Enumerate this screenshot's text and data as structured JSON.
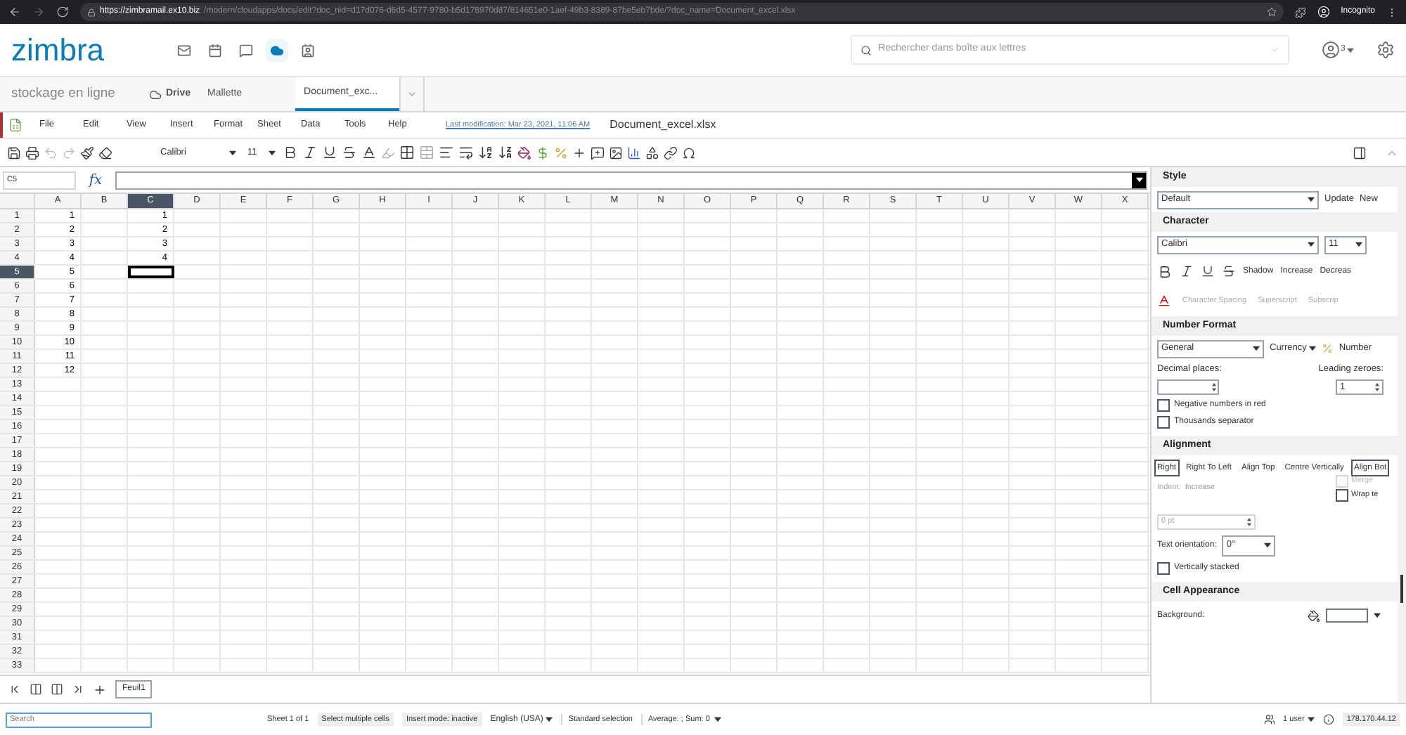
{
  "browser": {
    "url_host": "https://zimbramail.ex10.biz",
    "url_rest": "/modern/cloudapps/docs/edit?doc_nid=d17d076-d6d5-4577-9780-b5d178970d87/814651e0-1aef-49b3-8389-87be5eb7bde/?doc_name=Document_excel.xlsx",
    "profile": "Incognito"
  },
  "header": {
    "logo": "zimbra",
    "apps": [
      {
        "kind": "mail",
        "selected": false
      },
      {
        "kind": "calendar",
        "selected": false
      },
      {
        "kind": "chat",
        "selected": false
      },
      {
        "kind": "cloud",
        "selected": true
      },
      {
        "kind": "contacts",
        "selected": false
      }
    ],
    "search_placeholder": "Rechercher dans boîte aux lettres",
    "account_count": "3"
  },
  "tabs": {
    "title": "stockage en ligne",
    "items": [
      {
        "label": "Drive",
        "kind": "drive",
        "selected": false
      },
      {
        "label": "Mallette",
        "kind": "plain",
        "selected": false
      },
      {
        "label": "Document_exc...",
        "kind": "plain",
        "selected": true
      }
    ]
  },
  "menu": {
    "items": [
      "File",
      "Edit",
      "View",
      "Insert",
      "Format",
      "Sheet",
      "Data",
      "Tools",
      "Help"
    ],
    "last_modification": "Last modification: Mar 23, 2021, 11:06 AM",
    "document_title": "Document_excel.xlsx"
  },
  "toolbar": {
    "font": "Calibri",
    "size": "11"
  },
  "formula_bar": {
    "name_box": "C5",
    "fx": "fx"
  },
  "sheet": {
    "columns": [
      {
        "label": "A",
        "selected": false
      },
      {
        "label": "B",
        "selected": false
      },
      {
        "label": "C",
        "selected": true
      },
      {
        "label": "D",
        "selected": false
      },
      {
        "label": "E",
        "selected": false
      },
      {
        "label": "F",
        "selected": false
      },
      {
        "label": "G",
        "selected": false
      },
      {
        "label": "H",
        "selected": false
      },
      {
        "label": "I",
        "selected": false
      },
      {
        "label": "J",
        "selected": false
      },
      {
        "label": "K",
        "selected": false
      },
      {
        "label": "L",
        "selected": false
      },
      {
        "label": "M",
        "selected": false
      },
      {
        "label": "N",
        "selected": false
      },
      {
        "label": "O",
        "selected": false
      },
      {
        "label": "P",
        "selected": false
      },
      {
        "label": "Q",
        "selected": false
      },
      {
        "label": "R",
        "selected": false
      },
      {
        "label": "S",
        "selected": false
      },
      {
        "label": "T",
        "selected": false
      },
      {
        "label": "U",
        "selected": false
      },
      {
        "label": "V",
        "selected": false
      },
      {
        "label": "W",
        "selected": false
      },
      {
        "label": "X",
        "selected": false
      }
    ],
    "rows": [
      {
        "label": "1",
        "selected": false,
        "values": [
          "1",
          {
            "kind": "empty"
          },
          "1"
        ]
      },
      {
        "label": "2",
        "selected": false,
        "values": [
          "2",
          {
            "kind": "empty"
          },
          "2"
        ]
      },
      {
        "label": "3",
        "selected": false,
        "values": [
          "3",
          {
            "kind": "empty"
          },
          "3"
        ]
      },
      {
        "label": "4",
        "selected": false,
        "values": [
          "4",
          {
            "kind": "empty"
          },
          "4"
        ]
      },
      {
        "label": "5",
        "selected": true,
        "values": [
          "5"
        ]
      },
      {
        "label": "6",
        "selected": false,
        "values": [
          "6"
        ]
      },
      {
        "label": "7",
        "selected": false,
        "values": [
          "7"
        ]
      },
      {
        "label": "8",
        "selected": false,
        "values": [
          "8"
        ]
      },
      {
        "label": "9",
        "selected": false,
        "values": [
          "9"
        ]
      },
      {
        "label": "10",
        "selected": false,
        "values": [
          "10"
        ]
      },
      {
        "label": "11",
        "selected": false,
        "values": [
          "11"
        ]
      },
      {
        "label": "12",
        "selected": false,
        "values": [
          "12"
        ]
      },
      {
        "label": "13",
        "selected": false
      },
      {
        "label": "14",
        "selected": false
      },
      {
        "label": "15",
        "selected": false
      },
      {
        "label": "16",
        "selected": false
      },
      {
        "label": "17",
        "selected": false
      },
      {
        "label": "18",
        "selected": false
      },
      {
        "label": "19",
        "selected": false
      },
      {
        "label": "20",
        "selected": false
      },
      {
        "label": "21",
        "selected": false
      },
      {
        "label": "22",
        "selected": false
      },
      {
        "label": "23",
        "selected": false
      },
      {
        "label": "24",
        "selected": false
      },
      {
        "label": "25",
        "selected": false
      },
      {
        "label": "26",
        "selected": false
      },
      {
        "label": "27",
        "selected": false
      },
      {
        "label": "28",
        "selected": false
      },
      {
        "label": "29",
        "selected": false
      },
      {
        "label": "30",
        "selected": false
      },
      {
        "label": "31",
        "selected": false
      },
      {
        "label": "32",
        "selected": false
      },
      {
        "label": "33",
        "selected": false
      }
    ]
  },
  "sheet_tabs": [
    {
      "label": "Feuil1",
      "selected": true
    }
  ],
  "sidebar": {
    "style": {
      "title": "Style",
      "value": "Default",
      "buttons": [
        "Update",
        "New"
      ]
    },
    "character": {
      "title": "Character",
      "font": "Calibri",
      "size": "11",
      "buttons": [
        "Shadow",
        "Increase",
        "Decreas"
      ],
      "options": [
        {
          "label": "Character Spacing",
          "disabled": true
        },
        {
          "label": "Superscript",
          "disabled": true
        },
        {
          "label": "Subscrip",
          "disabled": true
        }
      ]
    },
    "number_format": {
      "title": "Number Format",
      "value": "General",
      "currency": "Currency",
      "number": "Number",
      "decimal_label": "Decimal places:",
      "leading_label": "Leading zeroes:",
      "leading_value": "1",
      "checkboxes": [
        {
          "label": "Negative numbers in red",
          "checked": false
        },
        {
          "label": "Thousands separator",
          "checked": false
        }
      ]
    },
    "alignment": {
      "title": "Alignment",
      "buttons": [
        {
          "label": "Right",
          "selected": true
        },
        {
          "label": "Right To Left",
          "selected": false
        },
        {
          "label": "Align Top",
          "selected": false
        },
        {
          "label": "Centre Vertically",
          "selected": false
        },
        {
          "label": "Align Bot",
          "selected": true
        }
      ],
      "indent_label": "Indent:",
      "indent_button": "Increase",
      "indent_disabled": true,
      "options": [
        {
          "label": "Merge",
          "checked": false,
          "disabled": true
        },
        {
          "label": "Wrap te",
          "checked": false,
          "disabled": false
        }
      ],
      "spacing_value": "0 pt",
      "orientation_label": "Text orientation:",
      "orientation_value": "0°",
      "stacked": {
        "label": "Vertically stacked",
        "checked": false
      }
    },
    "cell_appearance": {
      "title": "Cell Appearance",
      "background_label": "Background:"
    }
  },
  "status_bar": {
    "search_placeholder": "Search",
    "sheet": "Sheet 1 of 1",
    "selection_mode": "Select multiple cells",
    "insert_mode": "Insert mode: inactive",
    "language": "English (USA)",
    "selection": "Standard selection",
    "summary": "Average: ; Sum: 0",
    "users": "1 user",
    "ip": "178.170.44.12"
  }
}
